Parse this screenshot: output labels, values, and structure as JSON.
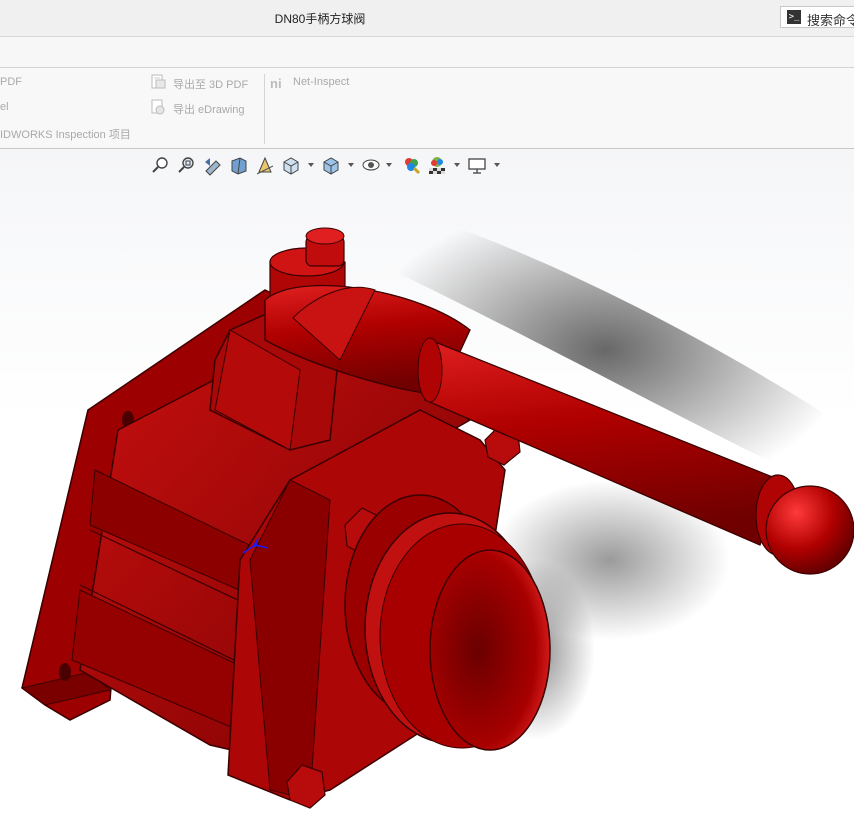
{
  "window": {
    "title": "DN80手柄方球阀"
  },
  "search": {
    "label": "搜索命令",
    "icon": "terminal-prompt-icon"
  },
  "ribbon": {
    "items": [
      {
        "label": "PDF",
        "icon": ""
      },
      {
        "label": "el",
        "icon": ""
      },
      {
        "label": "IDWORKS Inspection 项目",
        "icon": ""
      },
      {
        "label": "导出至 3D PDF",
        "icon": "export-3d-pdf-icon"
      },
      {
        "label": "导出 eDrawing",
        "icon": "export-edrawing-icon"
      },
      {
        "label": "Net-Inspect",
        "icon": "net-inspect-icon"
      }
    ]
  },
  "heads_up_toolbar": {
    "buttons": [
      {
        "name": "zoom-to-fit-icon"
      },
      {
        "name": "zoom-to-area-icon"
      },
      {
        "name": "previous-view-icon"
      },
      {
        "name": "section-view-icon"
      },
      {
        "name": "dynamic-annotation-views-icon"
      },
      {
        "name": "view-orientation-icon",
        "dropdown": true
      },
      {
        "name": "display-style-icon",
        "dropdown": true
      },
      {
        "name": "hide-show-items-icon",
        "dropdown": true
      },
      {
        "name": "edit-appearance-icon"
      },
      {
        "name": "apply-scene-icon",
        "dropdown": true
      },
      {
        "name": "view-settings-icon",
        "dropdown": true
      }
    ]
  },
  "colors": {
    "part_red": "#b00000",
    "part_red_dark": "#6e0000",
    "part_red_light": "#d51a1a",
    "ribbon_text_disabled": "#a9a9a9"
  }
}
